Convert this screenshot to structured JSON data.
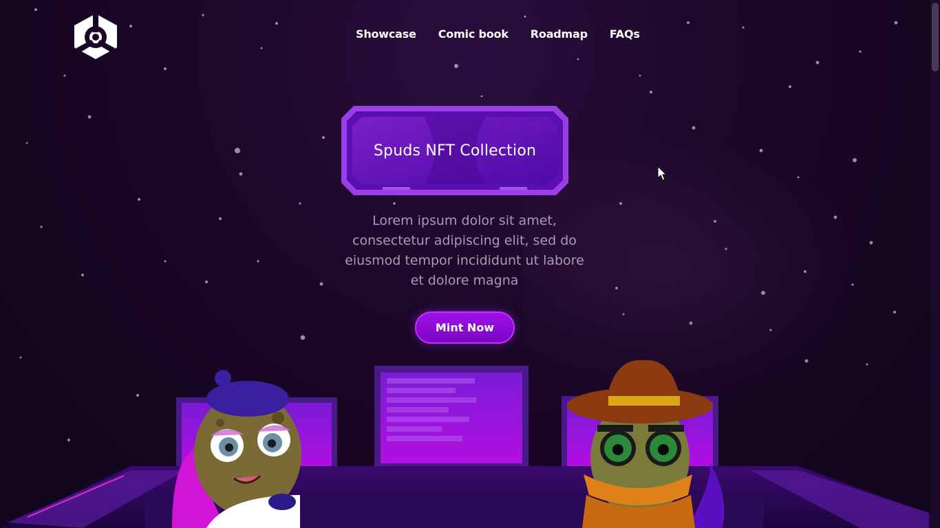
{
  "nav": {
    "items": [
      "Showcase",
      "Comic book",
      "Roadmap",
      "FAQs"
    ]
  },
  "hero": {
    "title": "Spuds NFT Collection",
    "description": "Lorem ipsum dolor sit amet, consectetur adipiscing elit, sed do eiusmod tempor incididunt ut labore et dolore magna",
    "cta_label": "Mint Now"
  },
  "colors": {
    "accent": "#a010e8",
    "background": "#1a0726",
    "text": "#ffffff",
    "muted_text": "#a79db0"
  },
  "icons": {
    "logo": "cube-logo-icon",
    "cursor": "mouse-pointer-icon"
  }
}
